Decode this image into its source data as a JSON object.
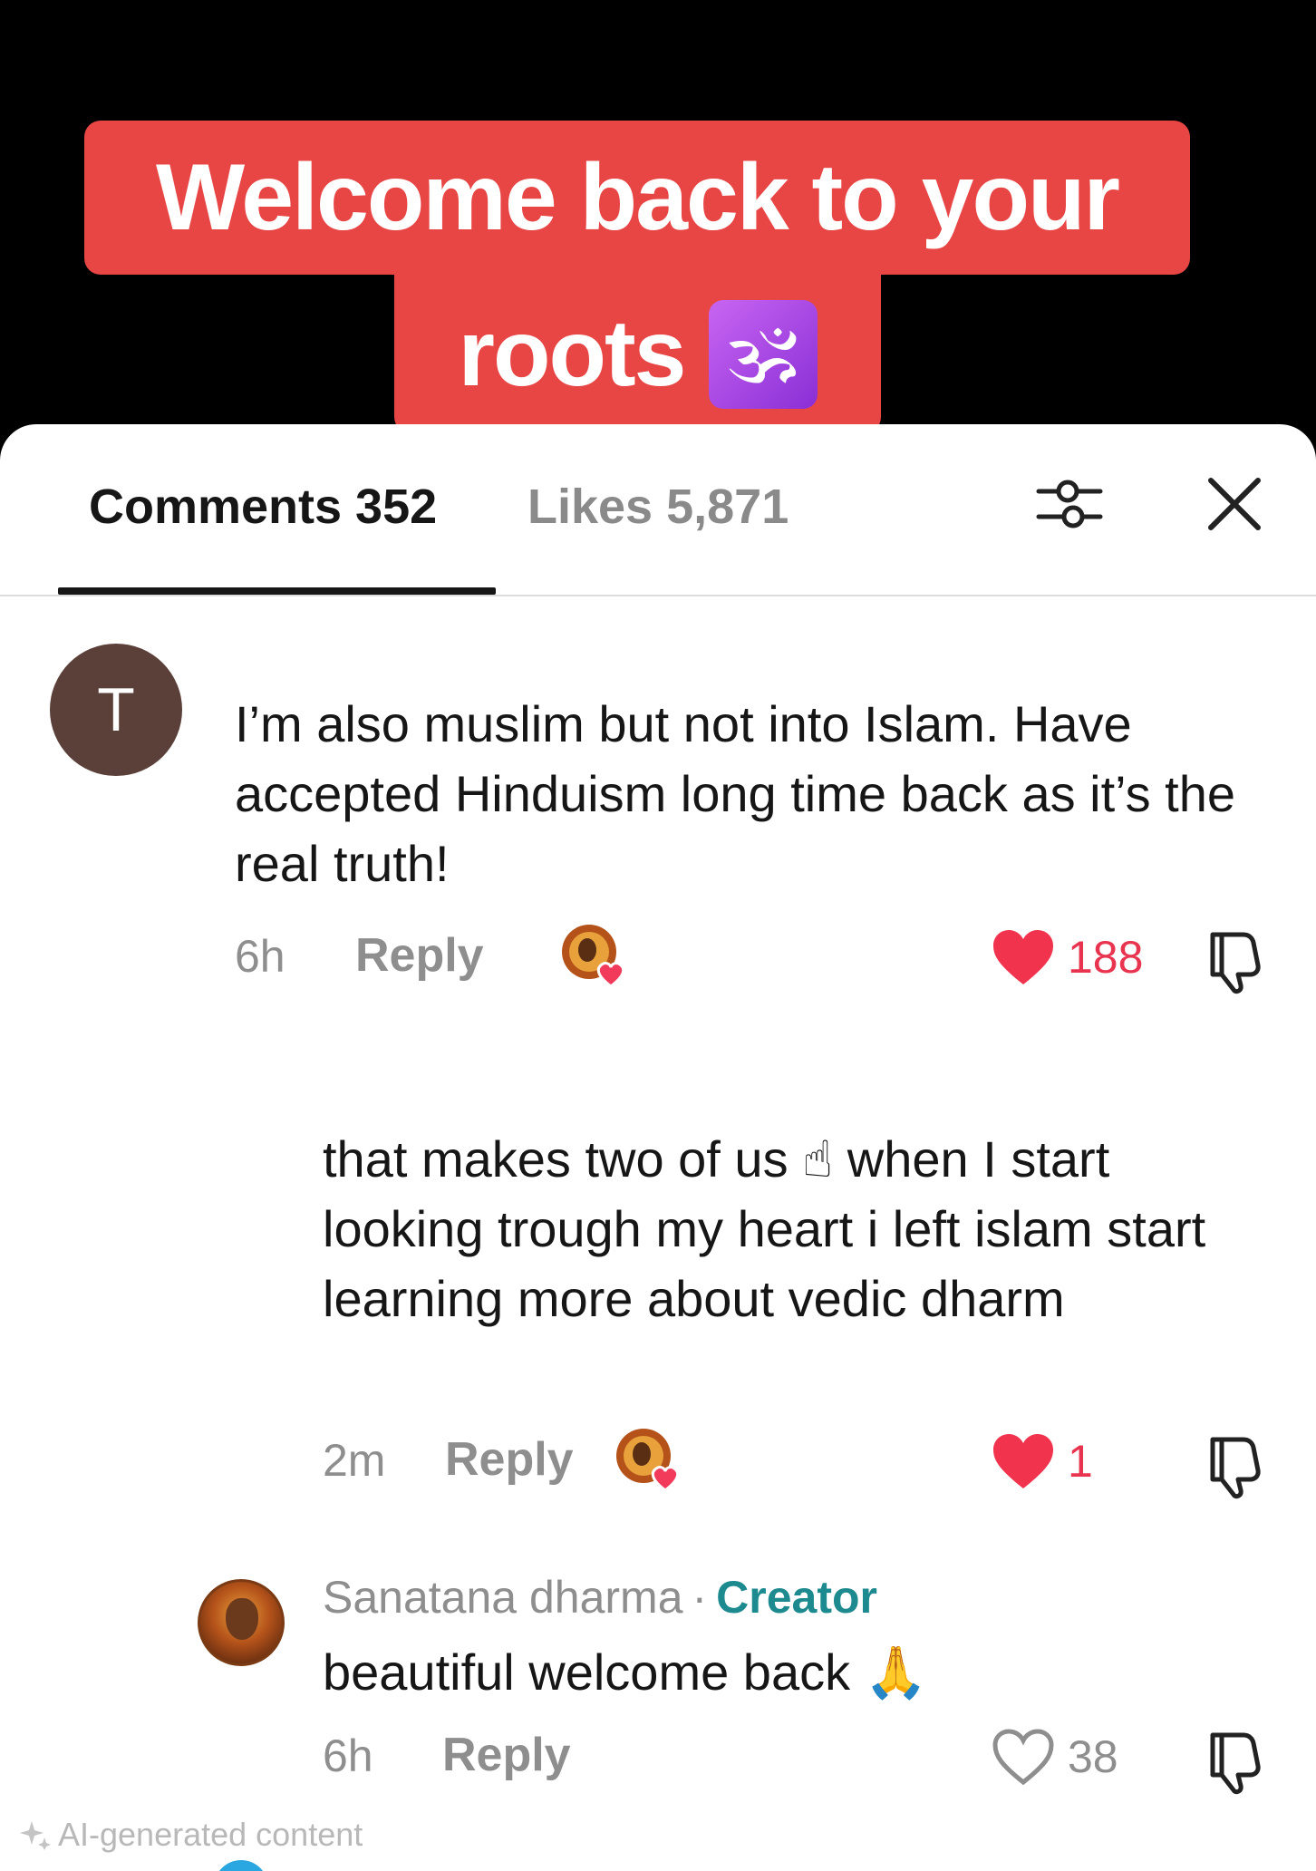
{
  "caption": {
    "line1": "Welcome back to your",
    "line2": "roots",
    "emoji": "🕉"
  },
  "tabs": {
    "comments": "Comments 352",
    "likes": "Likes 5,871"
  },
  "icons": {
    "filter": "filter-sliders-icon",
    "close": "close-icon",
    "heart": "heart-icon",
    "dislike": "thumbs-down-icon"
  },
  "colors": {
    "caption_bg": "#e84545",
    "like_red": "#e8344e",
    "creator_teal": "#1d8a8f"
  },
  "comments": [
    {
      "avatar_letter": "T",
      "text": "I’m also muslim but not into Islam. Have accepted Hinduism long time back as it’s the real truth!",
      "time": "6h",
      "reply": "Reply",
      "likes": "188",
      "liked": true
    },
    {
      "text": "that makes two of us ☝ when I start looking trough my heart i left islam start learning more about vedic dharm",
      "time": "2m",
      "reply": "Reply",
      "likes": "1",
      "liked": true
    },
    {
      "author": "Sanatana dharma",
      "separator": "·",
      "author_tag": "Creator",
      "text": "beautiful welcome back 🙏",
      "time": "6h",
      "reply": "Reply",
      "likes": "38",
      "liked": false
    }
  ],
  "footer": {
    "ai_label": "AI-generated content"
  }
}
